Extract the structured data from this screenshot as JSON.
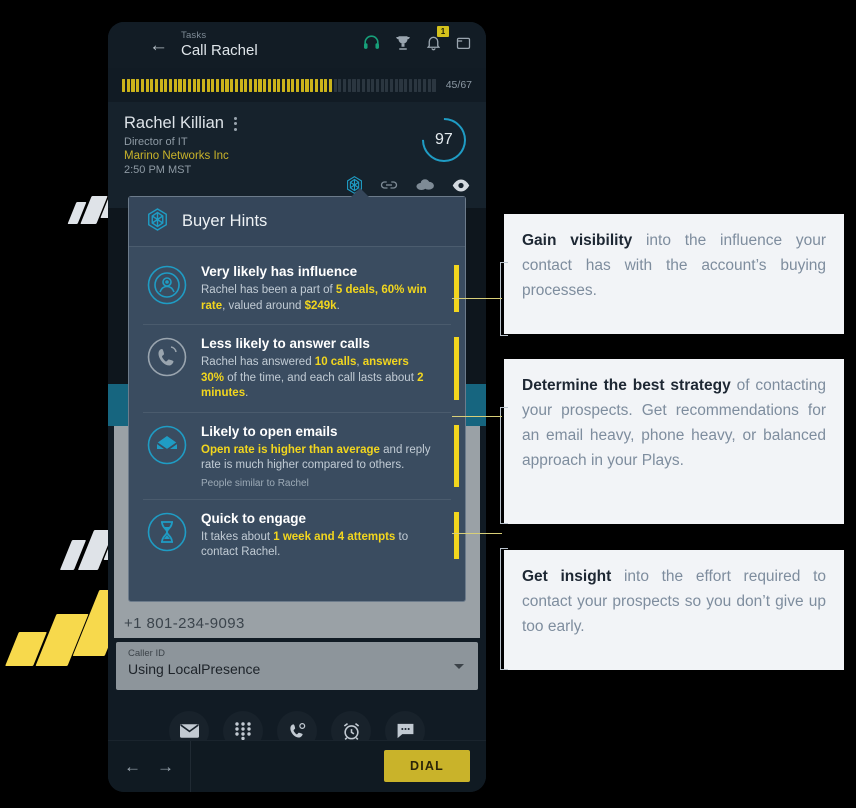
{
  "app": {
    "header": {
      "breadcrumb": "Tasks",
      "title": "Call Rachel",
      "icons": [
        "hamburger-icon",
        "back-arrow-icon",
        "headset-icon",
        "trophy-icon",
        "bell-icon",
        "window-icon"
      ],
      "notification_badge": "1"
    },
    "progress": {
      "label": "45/67",
      "completed": 45,
      "total": 67,
      "filled_color": "#cbb41b",
      "empty_color": "#2b3640"
    },
    "contact": {
      "name": "Rachel Killian",
      "role": "Director of IT",
      "company": "Marino Networks Inc",
      "local_time": "2:50 PM MST",
      "score": "97",
      "score_color": "#1f9cc4",
      "company_color": "#c9b32a",
      "row_icons": [
        "buyer-hints-polygon-icon",
        "link-icon",
        "salesforce-cloud-icon",
        "eye-icon"
      ]
    },
    "phone_number": "+1 801-234-9093",
    "caller_id": {
      "label": "Caller ID",
      "value": "Using LocalPresence"
    },
    "action_icons": [
      "email-icon",
      "dialpad-icon",
      "call-icon",
      "alarm-icon",
      "sms-icon"
    ],
    "bottom_bar": {
      "prev_label": "←",
      "next_label": "→",
      "dial_label": "DIAL",
      "dial_color": "#c9b32a"
    }
  },
  "hints_panel": {
    "title": "Buyer Hints",
    "panel_bg": "#3a4c60",
    "accent_color": "#f2d61e",
    "items": [
      {
        "icon": "influence-target-icon",
        "heading": "Very likely has influence",
        "body_parts": [
          {
            "t": "Rachel has been a part of ",
            "hl": false
          },
          {
            "t": "5 deals,",
            "hl": true
          },
          {
            "t": " ",
            "hl": false
          },
          {
            "t": "60% win rate",
            "hl": true
          },
          {
            "t": ", valued around ",
            "hl": false
          },
          {
            "t": "$249k",
            "hl": true
          },
          {
            "t": ".",
            "hl": false
          }
        ],
        "note": ""
      },
      {
        "icon": "phone-answer-icon",
        "heading": "Less likely to answer calls",
        "body_parts": [
          {
            "t": "Rachel has answered ",
            "hl": false
          },
          {
            "t": "10 calls",
            "hl": true
          },
          {
            "t": ", ",
            "hl": false
          },
          {
            "t": "answers 30%",
            "hl": true
          },
          {
            "t": " of the time, and each call lasts about ",
            "hl": false
          },
          {
            "t": "2 minutes",
            "hl": true
          },
          {
            "t": ".",
            "hl": false
          }
        ],
        "note": ""
      },
      {
        "icon": "open-envelope-icon",
        "heading": "Likely to open emails",
        "body_parts": [
          {
            "t": "Open rate is higher than average",
            "hl": true
          },
          {
            "t": " and reply rate is much higher compared to others.",
            "hl": false
          }
        ],
        "note": "People similar to Rachel"
      },
      {
        "icon": "hourglass-icon",
        "heading": "Quick to engage",
        "body_parts": [
          {
            "t": "It takes about ",
            "hl": false
          },
          {
            "t": "1 week and 4 attempts",
            "hl": true
          },
          {
            "t": " to contact Rachel.",
            "hl": false
          }
        ],
        "note": ""
      }
    ]
  },
  "callouts": [
    {
      "bold": "Gain visibility",
      "rest": " into the influence your contact has with the account’s buying processes."
    },
    {
      "bold": "Determine the best strategy",
      "rest": " of contacting your prospects. Get recommendations for an email heavy, phone heavy, or balanced approach in your Plays."
    },
    {
      "bold": "Get insight",
      "rest": " into the effort required to contact your prospects so you don’t give up too early."
    }
  ],
  "decor": {
    "light_slash_color": "#dfe3e8",
    "yellow_slash_color": "#f7d94c"
  }
}
